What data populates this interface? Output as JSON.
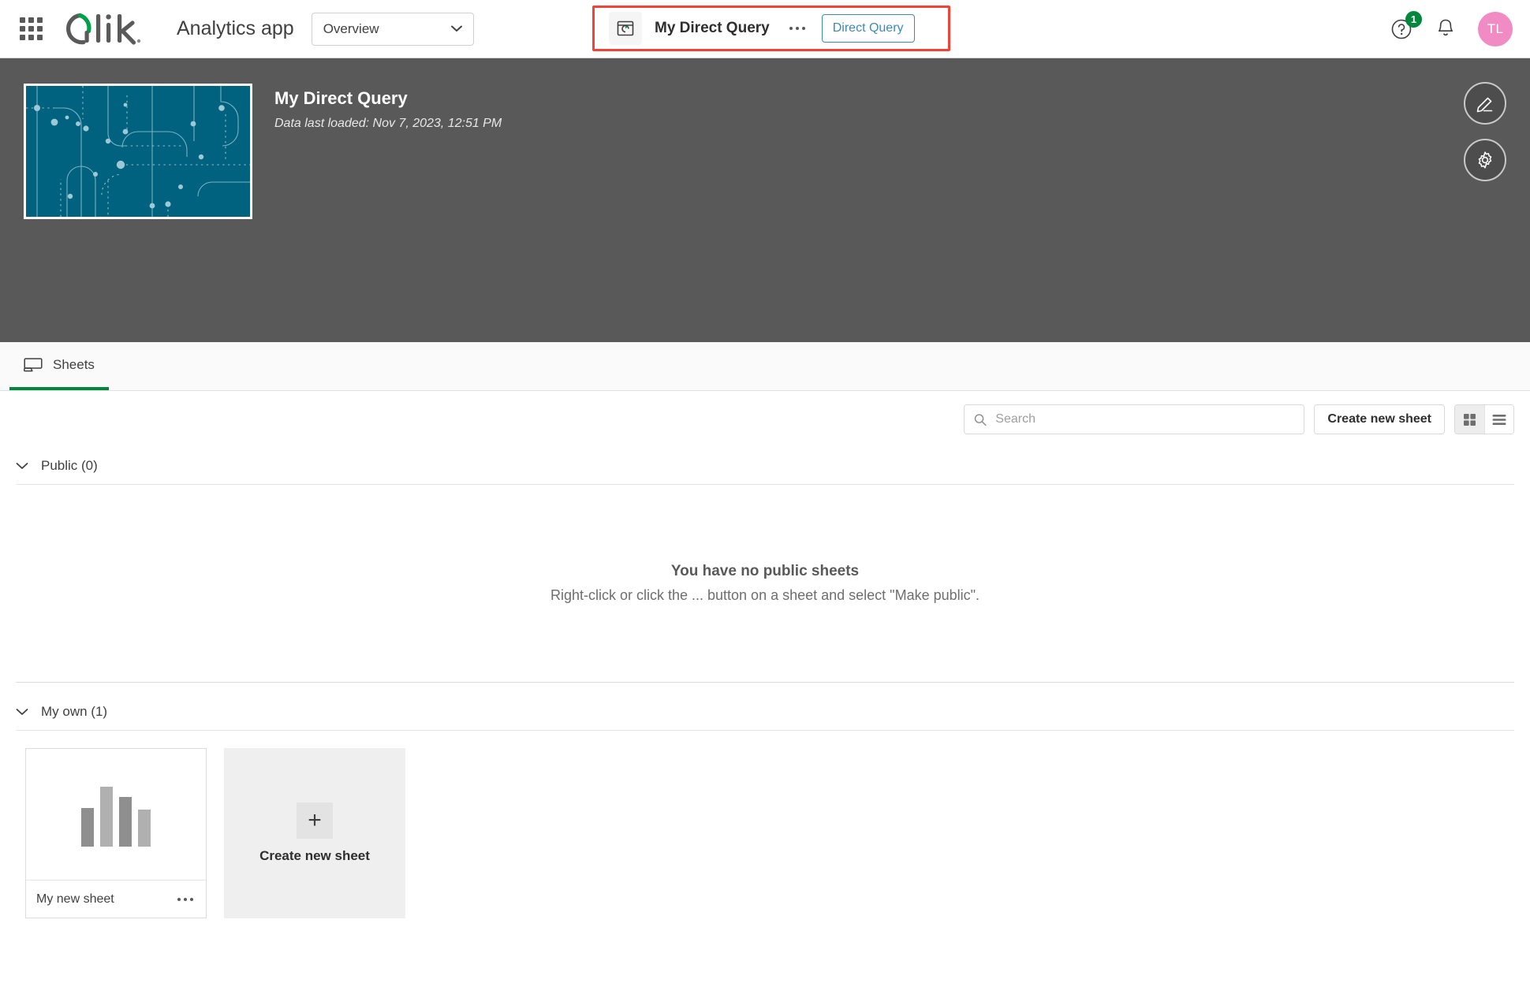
{
  "header": {
    "waffle_icon": "app-grid-icon",
    "logo_text": "Qlik",
    "app_kind": "Analytics app",
    "space_selector": {
      "value": "Overview",
      "chevron_icon": "chevron-down-icon"
    },
    "highlighted_group": {
      "app_icon": "direct-query-app-icon",
      "app_name": "My Direct Query",
      "more_icon": "ellipsis-icon",
      "badge_label": "Direct Query"
    },
    "help": {
      "icon": "help-circle-icon",
      "badge_count": "1"
    },
    "notifications_icon": "bell-icon",
    "avatar_initials": "TL"
  },
  "hero": {
    "thumbnail_alt": "app-thumbnail",
    "title": "My Direct Query",
    "subtitle": "Data last loaded: Nov 7, 2023, 12:51 PM",
    "edit_icon": "pencil-icon",
    "settings_icon": "gear-icon"
  },
  "tabs": [
    {
      "label": "Sheets",
      "icon": "sheet-icon",
      "active": true
    }
  ],
  "toolbar": {
    "search_placeholder": "Search",
    "search_value": "",
    "search_icon": "search-icon",
    "create_sheet_label": "Create new sheet",
    "grid_view_icon": "grid-view-icon",
    "list_view_icon": "list-view-icon"
  },
  "sections": {
    "public": {
      "title": "Public (0)",
      "caret_icon": "chevron-down-icon",
      "empty_title": "You have no public sheets",
      "empty_subtitle": "Right-click or click the ... button on a sheet and select \"Make public\"."
    },
    "my_own": {
      "title": "My own (1)",
      "caret_icon": "chevron-down-icon",
      "sheets": [
        {
          "name": "My new sheet",
          "more_icon": "ellipsis-icon",
          "preview_type": "bar-chart",
          "preview_bars": [
            55,
            85,
            70,
            52
          ]
        }
      ],
      "create_card": {
        "plus_icon": "plus-icon",
        "label": "Create new sheet"
      }
    }
  },
  "colors": {
    "brand_green": "#00873d",
    "accent_blue": "#3f8ab3",
    "highlight_red": "#f44336",
    "hero_bg": "#595959",
    "thumb_teal": "#00627f",
    "avatar_pink": "#f08bc4"
  }
}
